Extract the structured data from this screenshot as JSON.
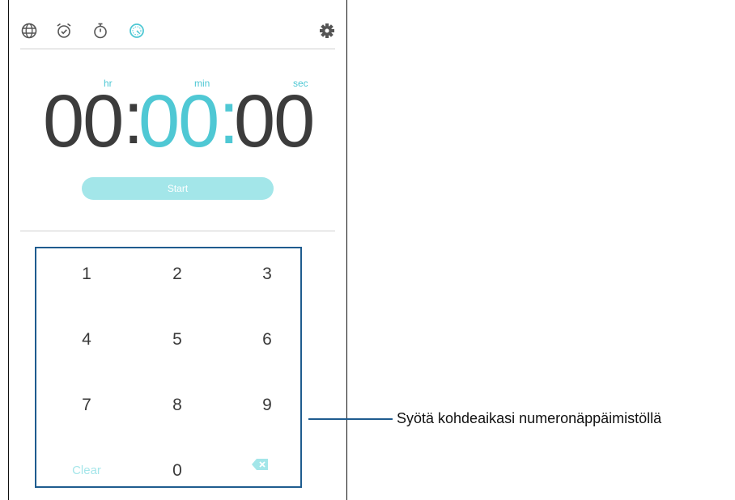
{
  "app": {
    "tabs": [
      {
        "icon": "globe-icon"
      },
      {
        "icon": "alarm-clock-icon"
      },
      {
        "icon": "stopwatch-icon"
      },
      {
        "icon": "timer-icon",
        "active": true
      }
    ],
    "settings_icon": "gear-icon"
  },
  "timer": {
    "labels": {
      "hr": "hr",
      "min": "min",
      "sec": "sec"
    },
    "hours": "00",
    "minutes": "00",
    "seconds": "00",
    "colon": ":",
    "active_field": "min",
    "start_label": "Start"
  },
  "keypad": {
    "keys": [
      "1",
      "2",
      "3",
      "4",
      "5",
      "6",
      "7",
      "8",
      "9"
    ],
    "clear_label": "Clear",
    "zero": "0",
    "backspace_icon": "backspace-icon"
  },
  "callout": {
    "text": "Syötä kohdeaikasi numeronäppäimistöllä"
  },
  "colors": {
    "accent": "#4fc8d4",
    "accent_light": "#a3e6e9",
    "text_dark": "#3c3c3c",
    "callout_border": "#1f5c8f"
  }
}
